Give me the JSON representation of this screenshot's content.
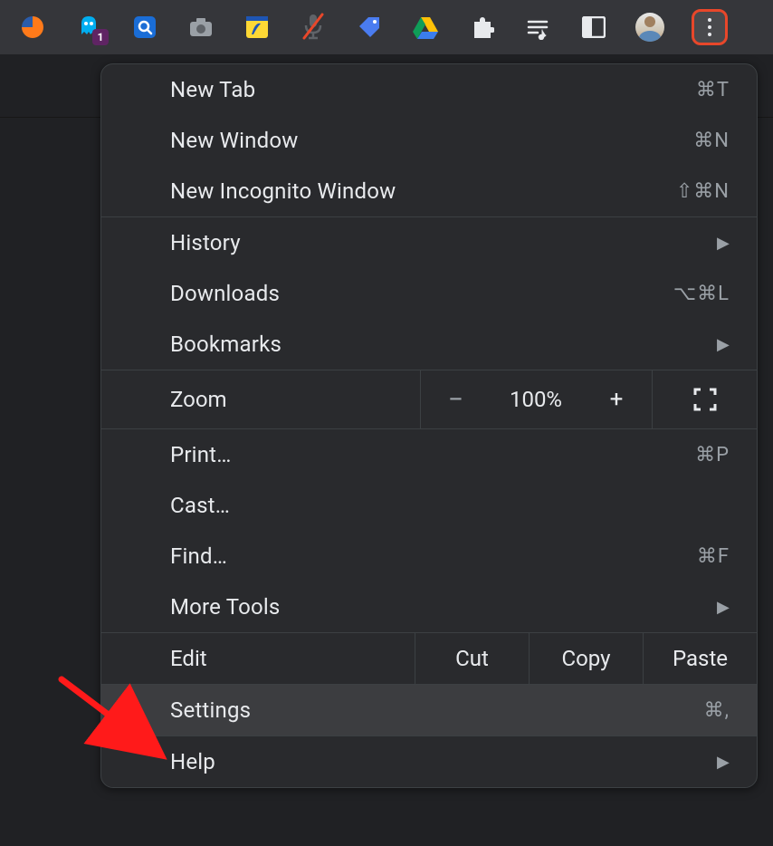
{
  "toolbar": {
    "extensions": [
      {
        "name": "similarweb-ext-icon"
      },
      {
        "name": "ghostery-ext-icon",
        "badge": "1"
      },
      {
        "name": "search-ext-icon"
      },
      {
        "name": "screenshot-ext-icon"
      },
      {
        "name": "notes-ext-icon"
      },
      {
        "name": "mic-mute-ext-icon"
      },
      {
        "name": "tag-ext-icon"
      },
      {
        "name": "drive-ext-icon"
      }
    ],
    "icons": {
      "extensions_puzzle": "puzzle-icon",
      "media": "media-controls-icon",
      "sidepanel": "sidepanel-icon",
      "avatar": "avatar-icon",
      "menu": "more-vert-icon"
    }
  },
  "menu": {
    "new_tab": {
      "label": "New Tab",
      "shortcut": "⌘T"
    },
    "new_window": {
      "label": "New Window",
      "shortcut": "⌘N"
    },
    "incognito": {
      "label": "New Incognito Window",
      "shortcut": "⇧⌘N"
    },
    "history": {
      "label": "History"
    },
    "downloads": {
      "label": "Downloads",
      "shortcut": "⌥⌘L"
    },
    "bookmarks": {
      "label": "Bookmarks"
    },
    "zoom": {
      "label": "Zoom",
      "value": "100%"
    },
    "print": {
      "label": "Print…",
      "shortcut": "⌘P"
    },
    "cast": {
      "label": "Cast…"
    },
    "find": {
      "label": "Find…",
      "shortcut": "⌘F"
    },
    "more_tools": {
      "label": "More Tools"
    },
    "edit": {
      "label": "Edit",
      "cut": "Cut",
      "copy": "Copy",
      "paste": "Paste"
    },
    "settings": {
      "label": "Settings",
      "shortcut": "⌘,"
    },
    "help": {
      "label": "Help"
    }
  },
  "annotation": {
    "target": "settings",
    "highlight_button": "more-vert-icon"
  }
}
